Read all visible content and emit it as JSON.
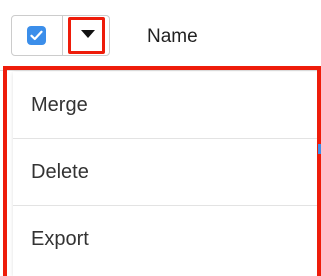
{
  "header": {
    "column_name": "Name",
    "checkbox_checked": true
  },
  "menu": {
    "items": [
      {
        "label": "Merge"
      },
      {
        "label": "Delete"
      },
      {
        "label": "Export"
      }
    ]
  },
  "colors": {
    "accent": "#3b8eea",
    "highlight": "#ee1c0a"
  }
}
